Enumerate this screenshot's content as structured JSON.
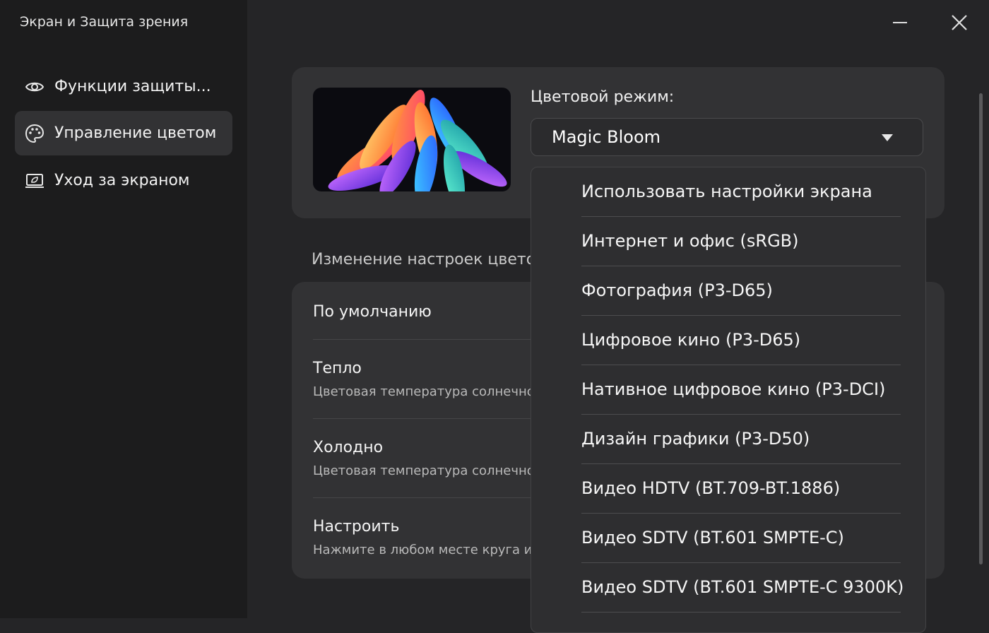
{
  "app": {
    "title": "Экран и Защита зрения"
  },
  "sidebar": {
    "items": [
      {
        "label": "Функции защиты...",
        "icon": "eye-icon",
        "active": false
      },
      {
        "label": "Управление цветом",
        "icon": "palette-icon",
        "active": true
      },
      {
        "label": "Уход за экраном",
        "icon": "screen-care-icon",
        "active": false
      }
    ]
  },
  "color_mode": {
    "label": "Цветовой режим:",
    "selected": "Magic Bloom"
  },
  "section": {
    "title": "Изменение настроек цвето"
  },
  "options": [
    {
      "title": "По умолчанию",
      "desc": ""
    },
    {
      "title": "Тепло",
      "desc": "Цветовая температура солнечно"
    },
    {
      "title": "Холодно",
      "desc": "Цветовая температура солнечно"
    },
    {
      "title": "Настроить",
      "desc": "Нажмите в любом месте круга и"
    }
  ],
  "dropdown": {
    "items": [
      "Использовать настройки экрана",
      "Интернет и офис (sRGB)",
      "Фотография (P3-D65)",
      "Цифровое кино (P3-D65)",
      "Нативное цифровое кино (P3-DCI)",
      "Дизайн графики (P3-D50)",
      "Видео HDTV (BT.709-BT.1886)",
      "Видео SDTV (BT.601 SMPTE-C)",
      "Видео SDTV (BT.601 SMPTE-C 9300K)"
    ]
  },
  "colors": {
    "background": "#252527",
    "sidebar": "#1c1c1d",
    "card": "#323234",
    "dropdown": "#2e2e30"
  }
}
